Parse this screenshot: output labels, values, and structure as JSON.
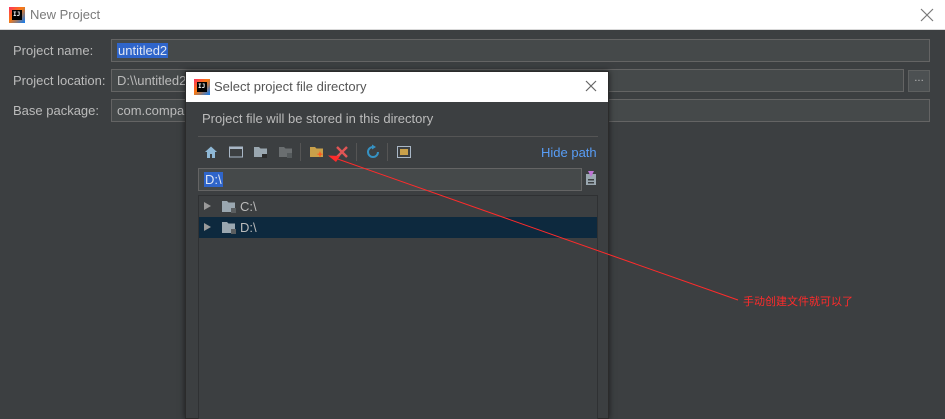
{
  "window": {
    "title": "New Project"
  },
  "form": {
    "project_name_label": "Project name:",
    "project_name_value": "untitled2",
    "project_location_label": "Project location:",
    "project_location_value": "D:\\\\untitled2",
    "base_package_label": "Base package:",
    "base_package_value": "com.company",
    "browse_label": "..."
  },
  "dialog": {
    "title": "Select project file directory",
    "description": "Project file will be stored in this directory",
    "hide_path_label": "Hide path",
    "path_value": "D:\\",
    "toolbar_icons": [
      "home-icon",
      "desktop-icon",
      "project-folder-icon",
      "module-folder-icon",
      "new-folder-icon",
      "delete-icon",
      "refresh-icon",
      "show-hidden-icon"
    ],
    "tree": [
      {
        "label": "C:\\",
        "selected": false
      },
      {
        "label": "D:\\",
        "selected": true
      }
    ]
  },
  "annotation": {
    "text": "手动创建文件就可以了",
    "color": "#ff2b2b"
  },
  "colors": {
    "background": "#3c3f41",
    "selection": "#2f65ca",
    "tree_selected": "#0d293e",
    "link": "#589df6"
  }
}
